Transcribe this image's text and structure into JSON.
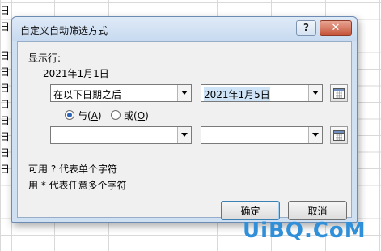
{
  "backdrop": {
    "left_column_cells": [
      "日",
      "日",
      "日",
      "日",
      "日",
      "日",
      "日",
      "日",
      "日",
      "日"
    ]
  },
  "dialog": {
    "title": "自定义自动筛选方式",
    "help_label": "?",
    "close_label": "✕",
    "show_rows_label": "显示行:",
    "field_label": "2021年1月1日",
    "condition1": {
      "operator": "在以下日期之后",
      "value": "2021年1月5日"
    },
    "logic": {
      "and_label": "与(A)",
      "and_text": "与(",
      "and_key": "A",
      "or_text": "或(",
      "or_key": "O",
      "close_paren": ")",
      "selected": "and"
    },
    "condition2": {
      "operator": "",
      "value": ""
    },
    "hint1": "可用 ? 代表单个字符",
    "hint2": "用 * 代表任意多个字符",
    "ok_label": "确定",
    "cancel_label": "取消"
  },
  "watermark": "UiBQ.CoM",
  "colors": {
    "accent": "#2d64b5",
    "close_button": "#c6563c",
    "watermark": "#2f8fd8"
  }
}
